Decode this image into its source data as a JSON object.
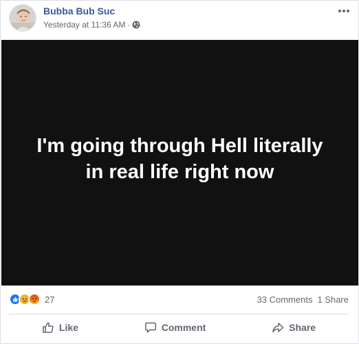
{
  "post": {
    "author": "Bubba Bub Suc",
    "timestamp": "Yesterday at 11:36 AM",
    "separator": "·",
    "privacy_icon": "globe-icon",
    "more_icon": "more-dots-icon",
    "image_text": "I'm going through Hell literally in real life right now"
  },
  "stats": {
    "reactions": [
      "like",
      "sad",
      "angry"
    ],
    "reaction_count": "27",
    "comments": "33 Comments",
    "shares": "1 Share"
  },
  "actions": {
    "like": "Like",
    "comment": "Comment",
    "share": "Share"
  },
  "colors": {
    "author_link": "#385898",
    "like_blue": "#1877f2",
    "image_bg": "#111111",
    "muted_text": "#606770"
  }
}
